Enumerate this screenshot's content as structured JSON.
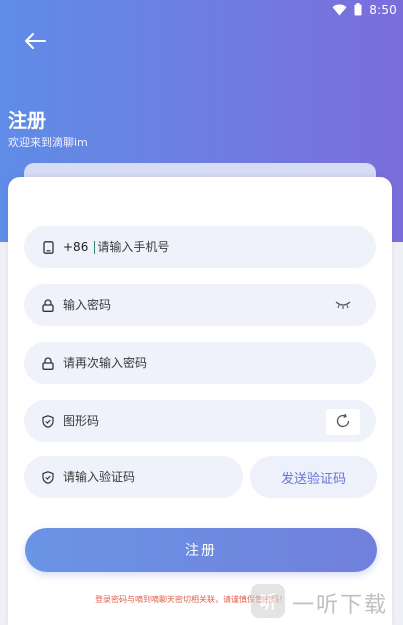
{
  "status_bar": {
    "time": "8:50"
  },
  "header": {
    "title": "注册",
    "subtitle": "欢迎来到滴聊im"
  },
  "form": {
    "phone": {
      "country_code": "+86",
      "placeholder": "请输入手机号",
      "value": ""
    },
    "password": {
      "placeholder": "输入密码",
      "value": ""
    },
    "confirm_password": {
      "placeholder": "请再次输入密码",
      "value": ""
    },
    "captcha": {
      "placeholder": "图形码",
      "value": ""
    },
    "verify_code": {
      "placeholder": "请输入验证码",
      "value": ""
    },
    "send_code_label": "发送验证码",
    "submit_label": "注册"
  },
  "agreement_text": "登录密码与嘀到嘀聊天密切相关联，请谨慎保管密码！",
  "watermark": {
    "text": "一听下载"
  },
  "colors": {
    "header_start": "#5f8ce6",
    "header_end": "#7a6ddb",
    "field_bg": "#eff1fb",
    "accent": "#6775d6",
    "agreement": "#e0604a"
  },
  "icons": {
    "back": "arrow-left-icon",
    "phone": "phone-icon",
    "lock": "lock-icon",
    "eye": "eye-closed-icon",
    "shield": "shield-icon",
    "refresh": "refresh-icon",
    "wifi": "wifi-icon",
    "battery": "battery-icon"
  }
}
